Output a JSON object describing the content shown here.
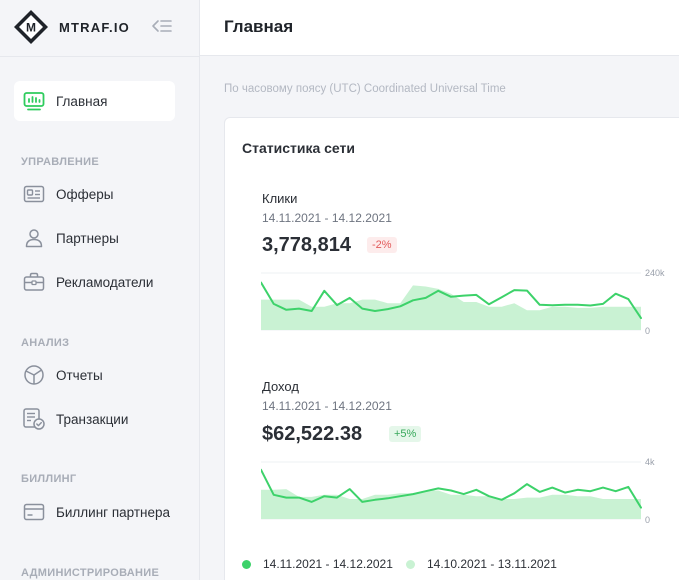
{
  "logo": {
    "text": "MTRAF.IO",
    "letter": "M"
  },
  "header": {
    "title": "Главная"
  },
  "timezone_note": "По часовому поясу (UTC) Coordinated Universal Time",
  "sidebar": {
    "home": "Главная",
    "sections": [
      {
        "title": "УПРАВЛЕНИЕ",
        "items": [
          "Офферы",
          "Партнеры",
          "Рекламодатели"
        ]
      },
      {
        "title": "АНАЛИЗ",
        "items": [
          "Отчеты",
          "Транзакции"
        ]
      },
      {
        "title": "БИЛЛИНГ",
        "items": [
          "Биллинг партнера"
        ]
      },
      {
        "title": "АДМИНИСТРИРОВАНИЕ",
        "items": []
      }
    ]
  },
  "card": {
    "title": "Статистика сети",
    "metrics": [
      {
        "label": "Клики",
        "range": "14.11.2021 - 14.12.2021",
        "value": "3,778,814",
        "change": "-2%"
      },
      {
        "label": "Доход",
        "range": "14.11.2021 - 14.12.2021",
        "value": "$62,522.38",
        "change": "+5%"
      }
    ],
    "legend": [
      "14.11.2021 - 14.12.2021",
      "14.10.2021 - 13.11.2021"
    ]
  },
  "colors": {
    "current": "#3dd26a",
    "previous": "#c9f2d3",
    "accent": "#2ecc5d"
  },
  "chart_data": [
    {
      "type": "line",
      "ylim": [
        0,
        240000
      ],
      "yticks": [
        "240k",
        "0"
      ],
      "series": [
        {
          "name": "14.11.2021 - 14.12.2021",
          "values": [
            200000,
            110000,
            85000,
            90000,
            80000,
            165000,
            105000,
            135000,
            90000,
            80000,
            88000,
            100000,
            125000,
            135000,
            165000,
            140000,
            145000,
            148000,
            108000,
            138000,
            168000,
            166000,
            106000,
            104000,
            106000,
            106000,
            103000,
            110000,
            153000,
            130000,
            50000
          ]
        },
        {
          "name": "14.10.2021 - 13.11.2021",
          "values": [
            128000,
            128000,
            128000,
            128000,
            98000,
            98000,
            113000,
            113000,
            128000,
            128000,
            113000,
            113000,
            188000,
            183000,
            173000,
            153000,
            118000,
            118000,
            98000,
            98000,
            113000,
            83000,
            83000,
            98000,
            98000,
            93000,
            93000,
            98000,
            98000,
            98000,
            98000
          ]
        }
      ]
    },
    {
      "type": "line",
      "ylim": [
        0,
        4000
      ],
      "yticks": [
        "4k",
        "0"
      ],
      "series": [
        {
          "name": "14.11.2021 - 14.12.2021",
          "values": [
            3450,
            1700,
            1500,
            1500,
            1200,
            1600,
            1500,
            2100,
            1200,
            1350,
            1450,
            1600,
            1750,
            1950,
            2150,
            2000,
            1750,
            2050,
            1600,
            1350,
            1800,
            2450,
            1900,
            2200,
            1850,
            2050,
            1950,
            2200,
            1950,
            2250,
            800
          ]
        },
        {
          "name": "14.10.2021 - 13.11.2021",
          "values": [
            2050,
            2050,
            2100,
            1550,
            1550,
            1700,
            1700,
            1400,
            1400,
            1700,
            1700,
            1800,
            1800,
            2000,
            2000,
            1700,
            1700,
            1600,
            1600,
            1400,
            1400,
            1500,
            1500,
            1700,
            1700,
            1600,
            1600,
            1400,
            1400,
            1400,
            1400
          ]
        }
      ]
    }
  ]
}
